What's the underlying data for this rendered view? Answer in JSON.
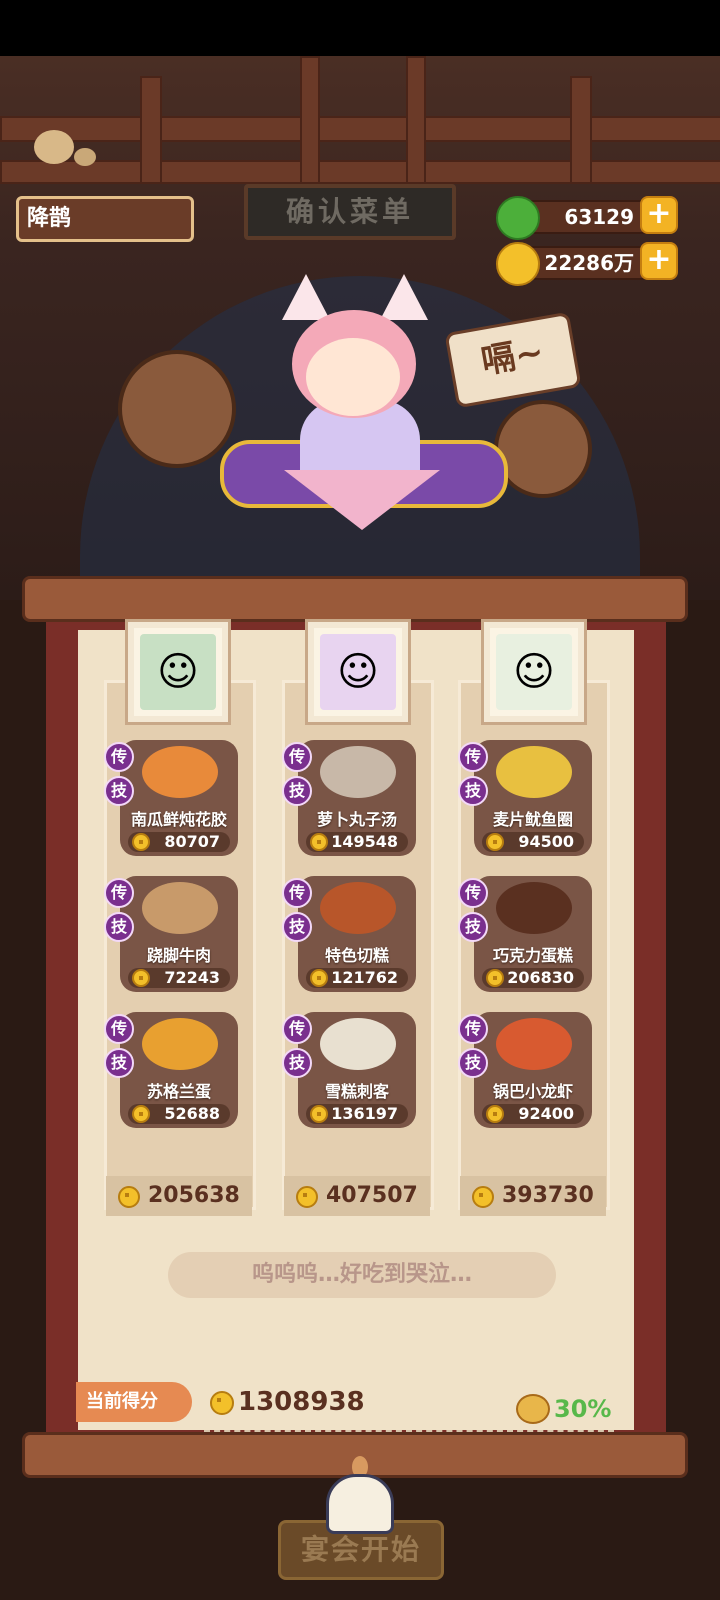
{
  "header": {
    "player_name": "降鹊",
    "sign_title": "确认菜单"
  },
  "resources": [
    {
      "name": "jade",
      "value": "63129",
      "icon": "jade-coin-icon",
      "color": "#4caf3a"
    },
    {
      "name": "gold",
      "value": "22286万",
      "icon": "gold-coin-icon",
      "color": "#f3c02a"
    }
  ],
  "speech_bubble": "嗝~",
  "guests": [
    {
      "portrait": "guest-green-hair-icon",
      "dishes": [
        {
          "name": "南瓜鲜炖花胶",
          "score": "80707",
          "badges": [
            "传",
            "技"
          ]
        },
        {
          "name": "跷脚牛肉",
          "score": "72243",
          "badges": [
            "传",
            "技"
          ]
        },
        {
          "name": "苏格兰蛋",
          "score": "52688",
          "badges": [
            "传",
            "技"
          ]
        }
      ],
      "total": "205638"
    },
    {
      "portrait": "guest-cat-ear-girl-icon",
      "dishes": [
        {
          "name": "萝卜丸子汤",
          "score": "149548",
          "badges": [
            "传",
            "技"
          ]
        },
        {
          "name": "特色切糕",
          "score": "121762",
          "badges": [
            "传",
            "技"
          ]
        },
        {
          "name": "雪糕刺客",
          "score": "136197",
          "badges": [
            "传",
            "技"
          ]
        }
      ],
      "total": "407507"
    },
    {
      "portrait": "guest-white-deer-icon",
      "dishes": [
        {
          "name": "麦片鱿鱼圈",
          "score": "94500",
          "badges": [
            "传",
            "技"
          ]
        },
        {
          "name": "巧克力蛋糕",
          "score": "206830",
          "badges": [
            "传",
            "技"
          ]
        },
        {
          "name": "锅巴小龙虾",
          "score": "92400",
          "badges": [
            "传",
            "技"
          ]
        }
      ],
      "total": "393730"
    }
  ],
  "message": "呜呜呜…好吃到哭泣…",
  "current_score": {
    "label": "当前得分",
    "value": "1308938"
  },
  "bonus": "30%",
  "start_button": "宴会开始",
  "colors": {
    "accent": "#f3b324",
    "badge": "#7a2f8e",
    "bonus": "#58b84a",
    "score_tag": "#e68a52"
  }
}
